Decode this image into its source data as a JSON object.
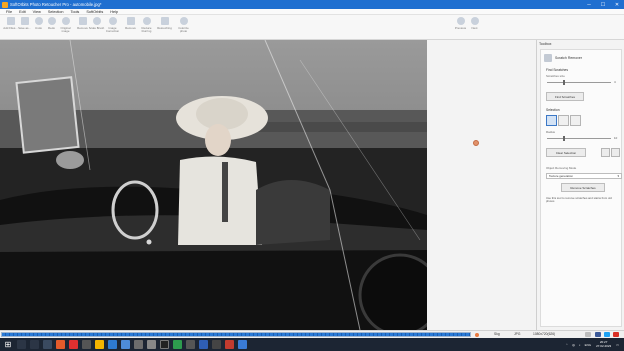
{
  "window": {
    "title": "SoftOrbits Photo Retoucher Pro - automobile.jpg*",
    "minimize": "─",
    "maximize": "☐",
    "close": "✕"
  },
  "menu": [
    "File",
    "Edit",
    "View",
    "Selection",
    "Tools",
    "SoftOrbits",
    "Help"
  ],
  "ribbon": {
    "buttons": [
      {
        "label": "Add Files...",
        "icon": "add-file-icon"
      },
      {
        "label": "Save as...",
        "icon": "save-icon"
      },
      {
        "label": "Undo",
        "icon": "undo-icon"
      },
      {
        "label": "Redo",
        "icon": "redo-icon"
      },
      {
        "label": "Original image",
        "icon": "original-image-icon"
      },
      {
        "label": "Remove",
        "icon": "remove-icon"
      },
      {
        "label": "Scale Brush",
        "icon": "scale-brush-icon"
      },
      {
        "label": "Image Correction",
        "icon": "image-correction-icon"
      },
      {
        "label": "Remove",
        "icon": "remove-object-icon"
      },
      {
        "label": "Reduce blurring",
        "icon": "reduce-blurring-icon"
      },
      {
        "label": "Retouching",
        "icon": "retouching-icon"
      },
      {
        "label": "Colorize photo",
        "icon": "colorize-icon"
      },
      {
        "label": "Previous",
        "icon": "previous-icon"
      },
      {
        "label": "Next",
        "icon": "next-icon"
      }
    ]
  },
  "toolbox": {
    "title": "Toolbox",
    "tool_name": "Scratch Remover",
    "find_scratches": {
      "heading": "Find Scratches",
      "size_label": "Scratches size",
      "size_value": "4",
      "size_fraction": 0.25,
      "button": "Find Scratches"
    },
    "selection": {
      "heading": "Selection",
      "radius_label": "Radius",
      "radius_value": "10",
      "radius_fraction": 0.25,
      "clear_button": "Clear Selection"
    },
    "mode": {
      "label": "Object Removing Mode",
      "value": "Texture generation",
      "button": "Remove Scratches"
    },
    "hint": "Use this tool to remove scratches and stains from old photos"
  },
  "status": {
    "progress_fraction": 1.0,
    "zoom": "Skg",
    "format": "JPG",
    "dimensions": "1080x720(626)"
  },
  "taskbar": {
    "tray_lang": "ENG",
    "time": "20:27",
    "date": "27.02.2023"
  },
  "colors": {
    "title_bar": "#1f6fd0",
    "progress": "#2a7ad6",
    "taskbar": "#1c2533"
  }
}
